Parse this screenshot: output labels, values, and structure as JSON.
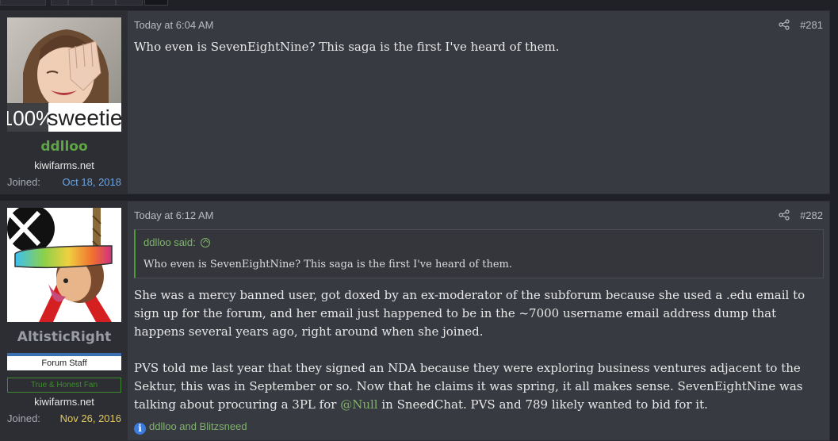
{
  "posts": [
    {
      "timestamp": "Today at 6:04 AM",
      "post_number": "#281",
      "author": {
        "username": "ddlloo",
        "username_color": "#5ea544",
        "avatar_caption_left": "100%",
        "avatar_caption_right": "sweetie",
        "site": "kiwifarms.net",
        "joined_label": "Joined:",
        "joined_date": "Oct 18, 2018"
      },
      "body": "Who even is SevenEightNine? This saga is the first I've heard of them."
    },
    {
      "timestamp": "Today at 6:12 AM",
      "post_number": "#282",
      "author": {
        "username": "AltisticRight",
        "username_color": "#9a9ca3",
        "staff_badge": "Forum Staff",
        "honest_badge": "True & Honest Fan",
        "site": "kiwifarms.net",
        "joined_label": "Joined:",
        "joined_date": "Nov 26, 2016"
      },
      "quote": {
        "header": "ddlloo said:",
        "text": "Who even is SevenEightNine? This saga is the first I've heard of them."
      },
      "body_paragraph_1": "She was a mercy banned user, got doxed by an ex-moderator of the subforum because she used a .edu email to sign up for the forum, and her email just happened to be in the ~7000 username email address dump that happens several years ago, right around when she joined.",
      "body_paragraph_2_before": "PVS told me last year that they signed an NDA because they were exploring business ventures adjacent to the Sektur, this was in September or so. Now that he claims it was spring, it all makes sense. SevenEightNine was talking about procuring a 3PL for ",
      "mention": "@Null",
      "body_paragraph_2_after": " in SneedChat. PVS and 789 likely wanted to bid for it.",
      "reactions": "ddlloo and Blitzsneed"
    }
  ],
  "icons": {
    "share": "share-icon",
    "info": "info-icon",
    "quote_jump": "arrow-up-circle-icon"
  },
  "colors": {
    "accent_green": "#7fb26a",
    "joined_date_blue": "#6aa7e8",
    "joined_date_yellow": "#e0c85c"
  }
}
